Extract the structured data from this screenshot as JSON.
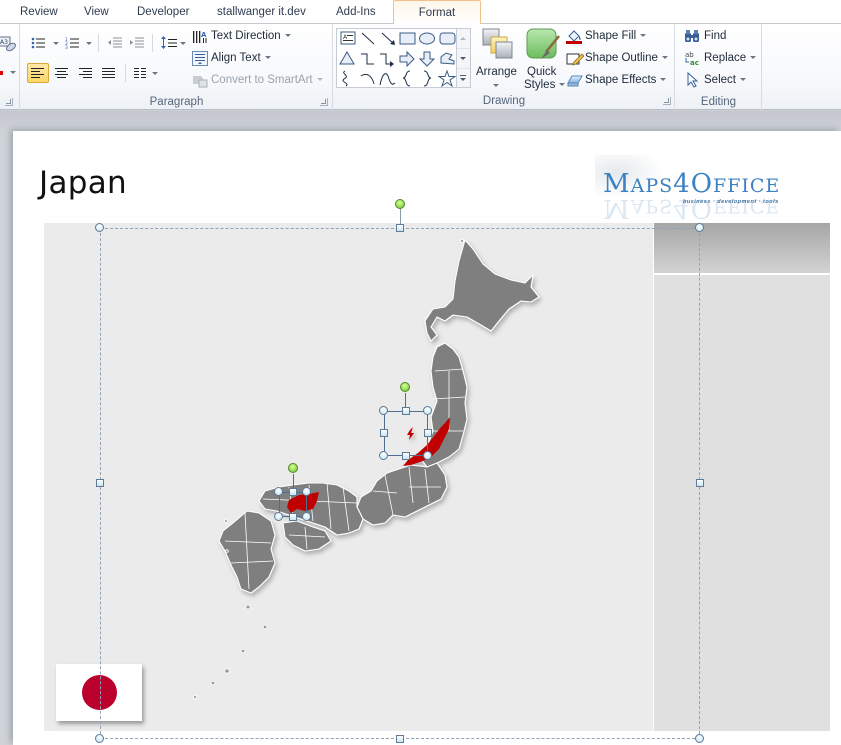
{
  "tabs": [
    {
      "label": "Review",
      "active": false
    },
    {
      "label": "View",
      "active": false
    },
    {
      "label": "Developer",
      "active": false
    },
    {
      "label": "stallwanger it.dev",
      "active": false
    },
    {
      "label": "Add-Ins",
      "active": false
    },
    {
      "label": "Format",
      "active": true
    }
  ],
  "ribbon": {
    "paragraph": {
      "label": "Paragraph",
      "text_direction": "Text Direction",
      "align_text": "Align Text",
      "convert_smartart": "Convert to SmartArt",
      "align_selected": "align-left"
    },
    "drawing": {
      "label": "Drawing",
      "arrange": "Arrange",
      "quick_styles_1": "Quick",
      "quick_styles_2": "Styles",
      "shape_fill": "Shape Fill",
      "shape_outline": "Shape Outline",
      "shape_effects": "Shape Effects",
      "fill_color": "#c00000"
    },
    "editing": {
      "label": "Editing",
      "find": "Find",
      "replace": "Replace",
      "select": "Select"
    }
  },
  "slide": {
    "title": "Japan",
    "logo": {
      "main_big_1": "M",
      "main_small_1": "APS",
      "main_big_2": "4O",
      "main_small_2": "FFICE",
      "tagline": "business · development · tools"
    },
    "map": {
      "land_color": "#7f7f7f",
      "highlight_color": "#c00000",
      "highlighted_regions": [
        "Niigata",
        "Hiroshima"
      ]
    },
    "flag": {
      "country": "Japan",
      "disc_color": "#bc002d"
    }
  }
}
